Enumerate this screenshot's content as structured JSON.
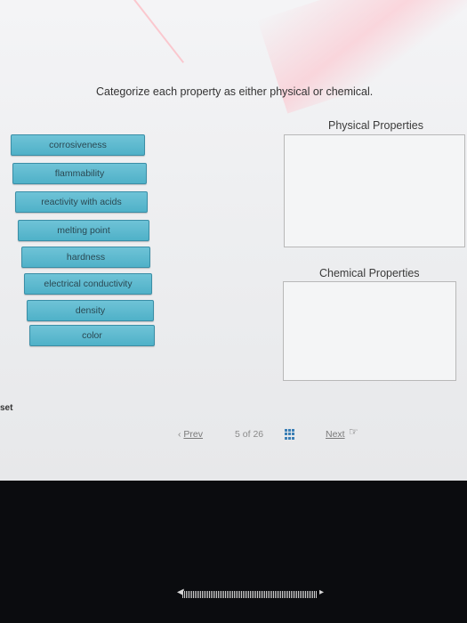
{
  "instruction": "Categorize each property as either physical or chemical.",
  "items": [
    "corrosiveness",
    "flammability",
    "reactivity with acids",
    "melting point",
    "hardness",
    "electrical conductivity",
    "density",
    "color"
  ],
  "zones": {
    "physical_title": "Physical Properties",
    "chemical_title": "Chemical Properties"
  },
  "sidebar": {
    "cut_label": "set"
  },
  "navigation": {
    "prev_label": "Prev",
    "page_current": "5",
    "page_of": "of",
    "page_total": "26",
    "next_label": "Next"
  },
  "colors": {
    "item_fill": "#56b5cb",
    "item_border": "#3a8ea6",
    "drop_zone_border": "#b8b8b8"
  }
}
